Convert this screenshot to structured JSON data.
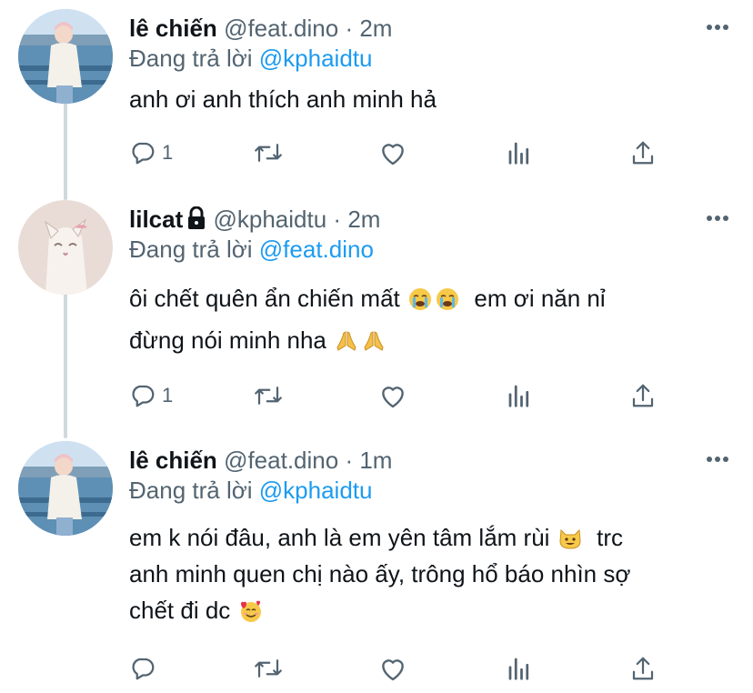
{
  "tweets": [
    {
      "name": "lê chiến",
      "handle": "@feat.dino",
      "separator": "·",
      "time": "2m",
      "replying_prefix": "Đang trả lời ",
      "replying_to": "@kphaidtu",
      "locked": false,
      "lines": [
        {
          "text": "anh ơi anh thích anh minh hả"
        }
      ],
      "reply_count": "1"
    },
    {
      "name": "lilcat",
      "handle": "@kphaidtu",
      "separator": "·",
      "time": "2m",
      "replying_prefix": "Đang trả lời ",
      "replying_to": "@feat.dino",
      "locked": true,
      "lines": [
        {
          "text": "ôi chết quên ẩn chiến mất ",
          "emojis": [
            "crying-face",
            "crying-face"
          ],
          "after": "  em ơi năn nỉ"
        },
        {
          "text": "đừng nói minh nha ",
          "emojis": [
            "folded-hands",
            "folded-hands"
          ],
          "after": ""
        }
      ],
      "reply_count": "1"
    },
    {
      "name": "lê chiến",
      "handle": "@feat.dino",
      "separator": "·",
      "time": "1m",
      "replying_prefix": "Đang trả lời ",
      "replying_to": "@kphaidtu",
      "locked": false,
      "lines": [
        {
          "text": "em k nói đâu, anh là em yên tâm lắm rùi ",
          "emojis": [
            "grinning-cat"
          ],
          "after": "  trc"
        },
        {
          "text": "anh minh quen chị nào ấy, trông hổ báo nhìn sợ"
        },
        {
          "text": "chết đi dc ",
          "emojis": [
            "smiling-face-with-hearts"
          ],
          "after": ""
        }
      ],
      "reply_count": ""
    }
  ],
  "icons": {
    "reply": "reply-icon",
    "retweet": "retweet-icon",
    "like": "heart-icon",
    "views": "analytics-icon",
    "share": "share-icon",
    "more": "more-icon",
    "lock": "lock-icon"
  },
  "colors": {
    "text": "#0f1419",
    "secondary": "#536471",
    "link": "#1d9bf0",
    "thread_line": "#cfd9de"
  }
}
